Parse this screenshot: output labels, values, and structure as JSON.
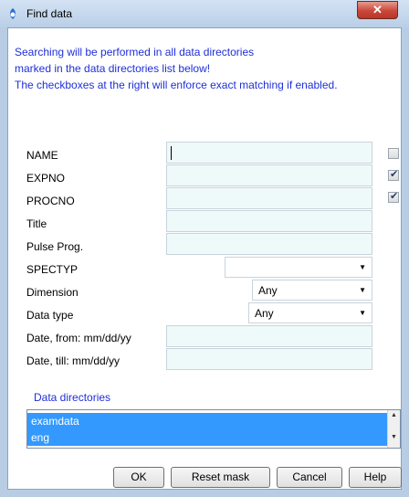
{
  "window": {
    "title": "Find data",
    "close_symbol": "✕"
  },
  "info_lines": [
    "Searching will be performed in all data directories",
    "marked in the data directories list below!",
    "The checkboxes at the right will enforce exact matching if enabled."
  ],
  "fields": {
    "name": {
      "label": "NAME",
      "value": "",
      "exact": false
    },
    "expno": {
      "label": "EXPNO",
      "value": "",
      "exact": true
    },
    "procno": {
      "label": "PROCNO",
      "value": "",
      "exact": true
    },
    "title": {
      "label": "Title",
      "value": ""
    },
    "pulse_prog": {
      "label": "Pulse Prog.",
      "value": ""
    },
    "spectyp": {
      "label": "SPECTYP",
      "value": ""
    },
    "dimension": {
      "label": "Dimension",
      "value": "Any"
    },
    "data_type": {
      "label": "Data type",
      "value": "Any"
    },
    "date_from": {
      "label": "Date, from: mm/dd/yy",
      "value": ""
    },
    "date_till": {
      "label": "Date, till: mm/dd/yy",
      "value": ""
    }
  },
  "check_mark": "✔",
  "data_directories": {
    "label": "Data directories",
    "items": [
      "examdata",
      "eng"
    ]
  },
  "buttons": {
    "ok": "OK",
    "reset": "Reset mask",
    "cancel": "Cancel",
    "help": "Help"
  },
  "colors": {
    "info_text": "#1f2fd9",
    "selection": "#3399ff",
    "field_bg": "#eefaf9"
  },
  "icons": {
    "app": "bruker-app-icon",
    "dropdown": "chevron-down-icon"
  }
}
